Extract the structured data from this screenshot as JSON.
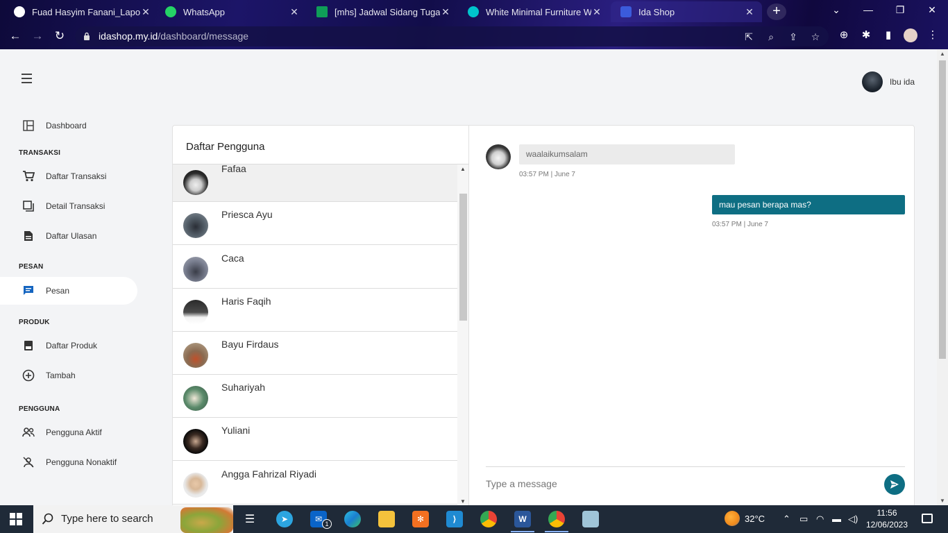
{
  "browser": {
    "tabs": [
      {
        "label": "Fuad Hasyim Fanani_Laporan",
        "favicon": "github-icon",
        "active": false
      },
      {
        "label": "WhatsApp",
        "favicon": "whatsapp-icon",
        "active": false
      },
      {
        "label": "[mhs] Jadwal Sidang Tugas A",
        "favicon": "sheets-icon",
        "active": false
      },
      {
        "label": "White Minimal Furniture Web",
        "favicon": "canva-icon",
        "active": false
      },
      {
        "label": "Ida Shop",
        "favicon": "bootstrap-icon",
        "active": true
      }
    ],
    "url_host": "idashop.my.id",
    "url_path": "/dashboard/message"
  },
  "header": {
    "user_name": "Ibu ida"
  },
  "sidebar": {
    "dashboard": "Dashboard",
    "sections": [
      {
        "title": "TRANSAKSI",
        "items": [
          "Daftar Transaksi",
          "Detail Transaksi",
          "Daftar Ulasan"
        ]
      },
      {
        "title": "PESAN",
        "items": [
          "Pesan"
        ]
      },
      {
        "title": "PRODUK",
        "items": [
          "Daftar Produk",
          "Tambah"
        ]
      },
      {
        "title": "PENGGUNA",
        "items": [
          "Pengguna Aktif",
          "Pengguna Nonaktif"
        ]
      }
    ],
    "active_item": "Pesan"
  },
  "users_panel": {
    "title": "Daftar Pengguna",
    "users": [
      {
        "name": "Fafaa",
        "active": true
      },
      {
        "name": "Priesca Ayu"
      },
      {
        "name": "Caca"
      },
      {
        "name": "Haris Faqih"
      },
      {
        "name": "Bayu Firdaus"
      },
      {
        "name": "Suhariyah"
      },
      {
        "name": "Yuliani"
      },
      {
        "name": "Angga Fahrizal Riyadi"
      }
    ]
  },
  "chat": {
    "messages": [
      {
        "direction": "in",
        "text": "waalaikumsalam",
        "time": "03:57 PM | June 7"
      },
      {
        "direction": "out",
        "text": "mau pesan berapa mas?",
        "time": "03:57 PM | June 7"
      }
    ],
    "input_placeholder": "Type a message",
    "accent_color": "#0e6e83"
  },
  "taskbar": {
    "search_placeholder": "Type here to search",
    "mail_badge": "1",
    "temperature": "32°C",
    "time": "11:56",
    "date": "12/06/2023"
  }
}
